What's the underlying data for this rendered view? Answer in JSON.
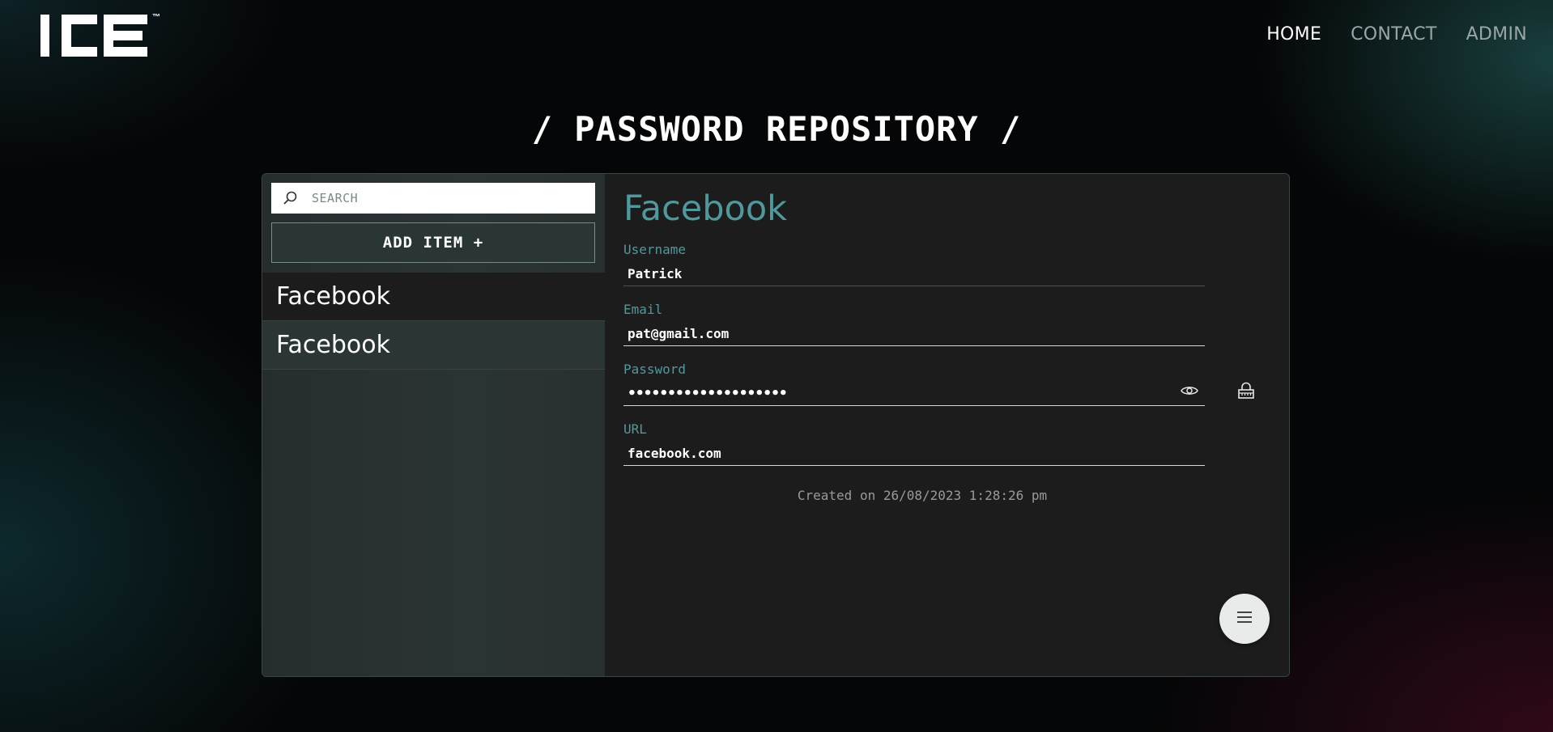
{
  "header": {
    "logo_text": "ICE",
    "logo_tm": "™",
    "nav": [
      {
        "label": "HOME"
      },
      {
        "label": "CONTACT"
      },
      {
        "label": "ADMIN"
      }
    ]
  },
  "page": {
    "title": "/ PASSWORD REPOSITORY /"
  },
  "sidebar": {
    "search": {
      "placeholder": "SEARCH",
      "value": ""
    },
    "add_button_label": "ADD ITEM +",
    "items": [
      {
        "label": "Facebook",
        "selected": true
      },
      {
        "label": "Facebook",
        "selected": false
      }
    ]
  },
  "detail": {
    "title": "Facebook",
    "username": {
      "label": "Username",
      "value": "Patrick"
    },
    "email": {
      "label": "Email",
      "value": "pat@gmail.com"
    },
    "password": {
      "label": "Password",
      "masked_value": "••••••••••••••••••••"
    },
    "url": {
      "label": "URL",
      "value": "facebook.com"
    },
    "created": "Created on 26/08/2023 1:28:26 pm"
  },
  "icons": {
    "search": "search-icon",
    "eye": "eye-icon",
    "lock": "lock-icon",
    "menu": "hamburger-menu-icon"
  },
  "colors": {
    "accent": "#4f999d",
    "background": "#050607",
    "panel": "#1c1c1c",
    "sidebar": "#2b3435"
  }
}
